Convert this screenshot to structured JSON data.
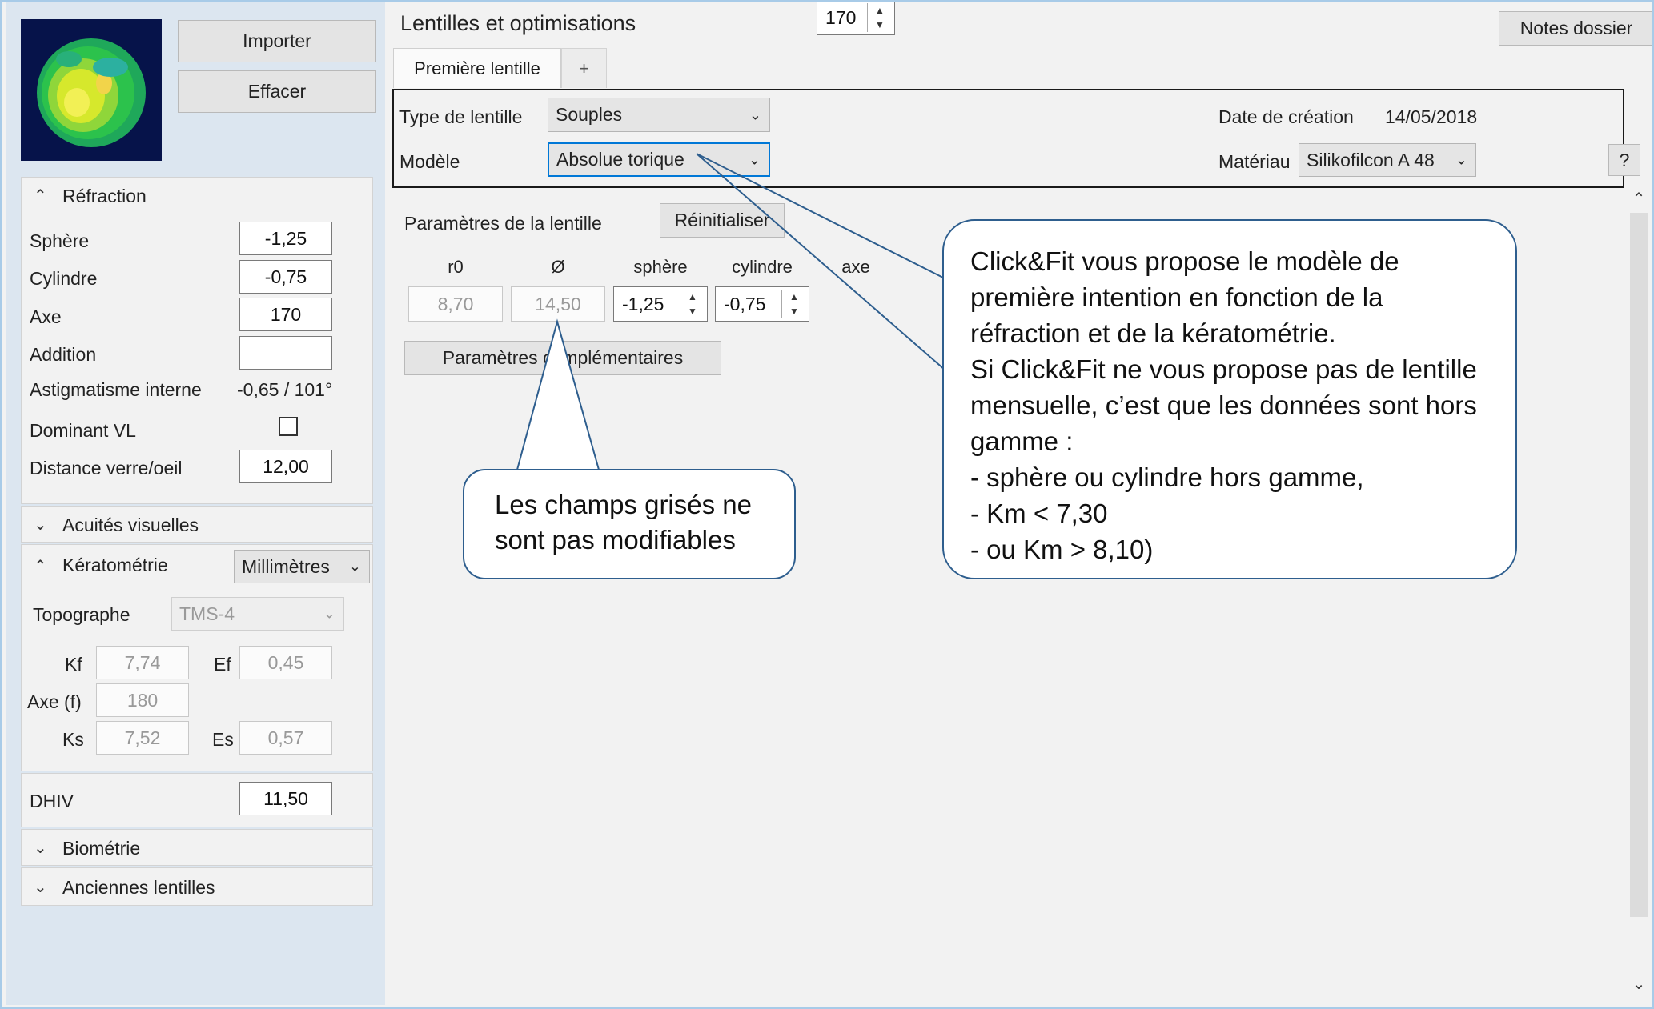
{
  "left_panel": {
    "import_button": "Importer",
    "clear_button": "Effacer",
    "refraction": {
      "title": "Réfraction",
      "rows": [
        {
          "label": "Sphère",
          "value": "-1,25"
        },
        {
          "label": "Cylindre",
          "value": "-0,75"
        },
        {
          "label": "Axe",
          "value": "170"
        },
        {
          "label": "Addition",
          "value": ""
        }
      ],
      "internal_astig_label": "Astigmatisme interne",
      "internal_astig_value": "-0,65 / 101°",
      "dominant_label": "Dominant VL",
      "dominant_checked": false,
      "distance_label": "Distance verre/oeil",
      "distance_value": "12,00"
    },
    "acuities_title": "Acuités visuelles",
    "keratometry": {
      "title": "Kératométrie",
      "unit": "Millimètres",
      "topographer_label": "Topographe",
      "topographer_value": "TMS-4",
      "kf_label": "Kf",
      "kf_value": "7,74",
      "ef_label": "Ef",
      "ef_value": "0,45",
      "axe_label": "Axe (f)",
      "axe_value": "180",
      "ks_label": "Ks",
      "ks_value": "7,52",
      "es_label": "Es",
      "es_value": "0,57"
    },
    "dhiv_label": "DHIV",
    "dhiv_value": "11,50",
    "biometry_title": "Biométrie",
    "old_lenses_title": "Anciennes lentilles"
  },
  "main": {
    "title": "Lentilles et optimisations",
    "notes_button": "Notes dossier",
    "tabs": [
      {
        "label": "Première lentille",
        "active": true
      },
      {
        "label": "+",
        "active": false
      }
    ],
    "lens_type_label": "Type de lentille",
    "lens_type_value": "Souples",
    "model_label": "Modèle",
    "model_value": "Absolue torique",
    "creation_label": "Date de création",
    "creation_value": "14/05/2018",
    "material_label": "Matériau",
    "material_value": "Silikofilcon A 48",
    "help_button": "?",
    "params_label": "Paramètres de la lentille",
    "reset_button": "Réinitialiser",
    "columns": [
      "r0",
      "Ø",
      "sphère",
      "cylindre",
      "axe"
    ],
    "values": [
      "8,70",
      "14,50",
      "-1,25",
      "-0,75",
      "170"
    ],
    "more_params_button": "Paramètres complémentaires"
  },
  "callouts": {
    "grey_fields": [
      "Les champs grisés ne",
      "sont pas modifiables"
    ],
    "clickfit": [
      "Click&Fit vous propose le modèle de",
      "première intention en fonction de la",
      "réfraction et de la kératométrie.",
      "Si Click&Fit ne vous propose pas de lentille",
      "mensuelle, c’est que les données sont hors",
      "gamme :",
      "-   sphère ou cylindre hors gamme,",
      "-    Km < 7,30",
      "-   ou Km > 8,10)"
    ]
  },
  "icons": {
    "chevron_up": "chevron-up-icon",
    "chevron_down": "chevron-down-icon",
    "dropdown": "dropdown-arrow-icon"
  },
  "colors": {
    "left_panel_bg": "#dce6f0",
    "window_border": "#a8cbe8",
    "callout_border": "#2e5e8e",
    "focus_border": "#0078d7"
  }
}
